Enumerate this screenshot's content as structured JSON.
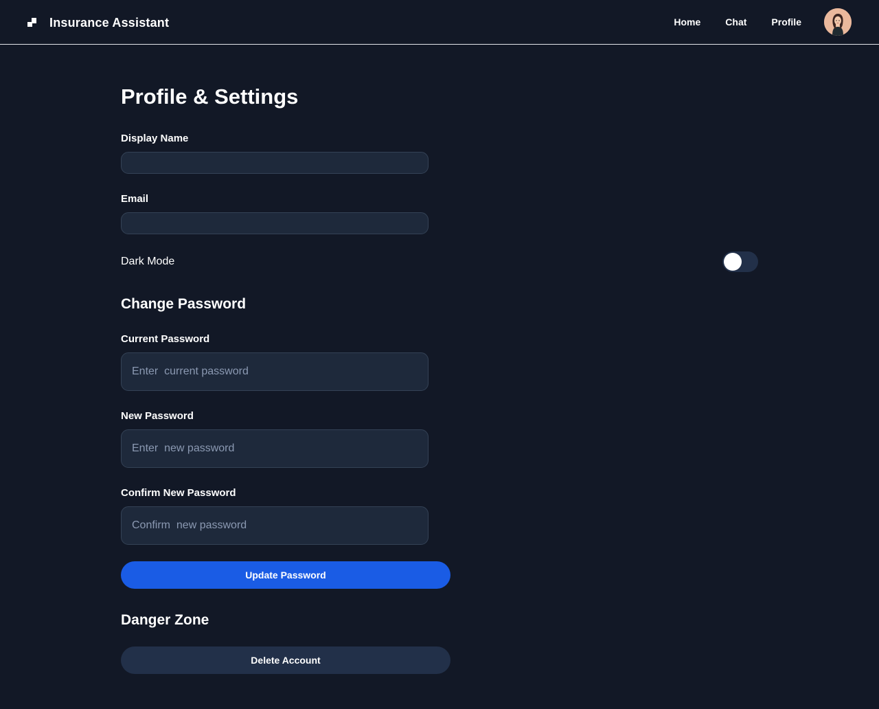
{
  "header": {
    "app_title": "Insurance Assistant",
    "logo_icon": "app-logo-icon",
    "nav": [
      "Home",
      "Chat",
      "Profile"
    ],
    "avatar_icon": "user-avatar"
  },
  "page": {
    "title": "Profile & Settings"
  },
  "profile": {
    "display_name_label": "Display Name",
    "display_name_value": "",
    "email_label": "Email",
    "email_value": "",
    "dark_mode_label": "Dark Mode",
    "dark_mode_on": false
  },
  "password": {
    "section_title": "Change Password",
    "current_label": "Current Password",
    "current_placeholder": "Enter  current password",
    "new_label": "New Password",
    "new_placeholder": "Enter  new password",
    "confirm_label": "Confirm New Password",
    "confirm_placeholder": "Confirm  new password",
    "update_button": "Update Password"
  },
  "danger": {
    "section_title": "Danger Zone",
    "delete_button": "Delete Account"
  },
  "colors": {
    "background": "#121826",
    "input_bg": "#1e293b",
    "primary": "#1a5ce5",
    "secondary_button": "#223049"
  }
}
